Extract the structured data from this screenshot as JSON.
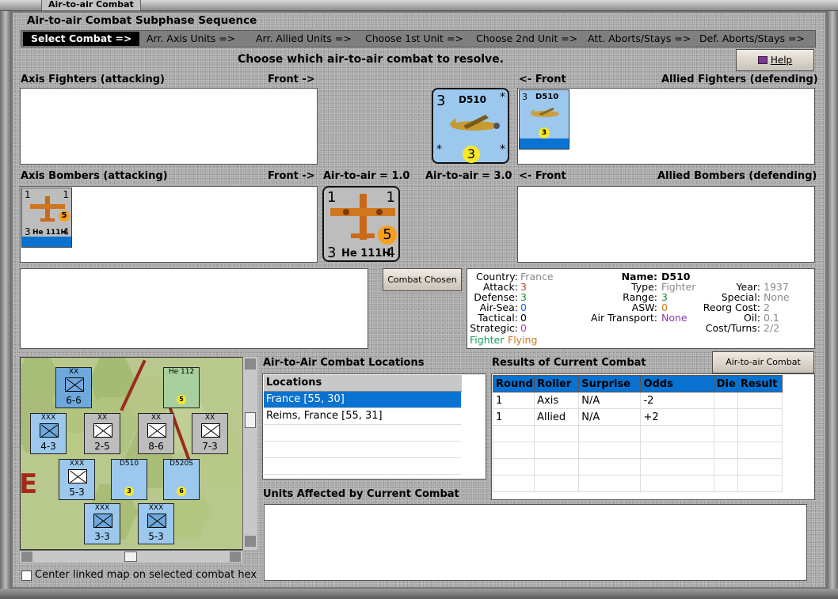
{
  "window": {
    "title": "Air-to-air Combat"
  },
  "sequence": {
    "group_title": "Air-to-air Combat Subphase Sequence",
    "steps": [
      "Select Combat =>",
      "Arr. Axis Units =>",
      "Arr. Allied Units =>",
      "Choose 1st Unit =>",
      "Choose 2nd Unit =>",
      "Att. Aborts/Stays =>",
      "Def. Aborts/Stays =>"
    ]
  },
  "instruction": "Choose which air-to-air combat to resolve.",
  "help_button": "Help",
  "axis_fighters": {
    "label": "Axis Fighters (attacking)",
    "front": "Front ->"
  },
  "allied_fighters": {
    "label": "Allied Fighters (defending)",
    "front": "<- Front"
  },
  "axis_bombers": {
    "label": "Axis Bombers (attacking)",
    "front": "Front ->",
    "air_to_air": "Air-to-air = 1.0"
  },
  "allied_bombers": {
    "label": "Allied Bombers (defending)",
    "front": "<- Front",
    "air_to_air": "Air-to-air = 3.0"
  },
  "allied_fighter_counter": {
    "name": "D510",
    "left_value": "3",
    "bottom_value": "3",
    "corner": "*"
  },
  "axis_bomber_counter": {
    "name": "He 111H",
    "top_left": "1",
    "top_right": "1",
    "bottom_left": "3",
    "bottom_right": "4",
    "badge": "5"
  },
  "combat_chosen_button": "Combat Chosen",
  "unit_info": {
    "country_label": "Country:",
    "country": "France",
    "attack_label": "Attack:",
    "attack": "3",
    "defense_label": "Defense:",
    "defense": "3",
    "air_sea_label": "Air-Sea:",
    "air_sea": "0",
    "tactical_label": "Tactical:",
    "tactical": "0",
    "strategic_label": "Strategic:",
    "strategic": "0",
    "tags": [
      "Fighter",
      "Flying"
    ],
    "name_label": "Name:",
    "name": "D510",
    "type_label": "Type:",
    "type": "Fighter",
    "range_label": "Range:",
    "range": "3",
    "asw_label": "ASW:",
    "asw": "0",
    "air_transport_label": "Air Transport:",
    "air_transport": "None",
    "year_label": "Year:",
    "year": "1937",
    "special_label": "Special:",
    "special": "None",
    "reorg_label": "Reorg Cost:",
    "reorg": "2",
    "oil_label": "Oil:",
    "oil": "0.1",
    "cost_label": "Cost/Turns:",
    "cost": "2/2",
    "colors": {
      "attack": "#c0392b",
      "defense": "#1a8a2e",
      "air_sea": "#1f5fd0",
      "strategic": "#b43ab4",
      "fighter": "#16a05a",
      "flying": "#c8781e",
      "muted": "#8a8a8a",
      "air_transport": "#8a3aa8",
      "asw": "#d07c1a"
    }
  },
  "locations": {
    "title": "Air-to-Air Combat Locations",
    "header": "Locations",
    "rows": [
      "France [55, 30]",
      "Reims, France [55, 31]",
      "",
      "",
      "",
      ""
    ]
  },
  "results": {
    "title": "Results of Current Combat",
    "chart_button": "Air-to-air Combat Chart",
    "columns": [
      "Round",
      "Roller",
      "Surprise",
      "Odds",
      "Die",
      "Result"
    ],
    "rows": [
      [
        "1",
        "Axis",
        "N/A",
        "-2",
        "",
        ""
      ],
      [
        "1",
        "Allied",
        "N/A",
        "+2",
        "",
        ""
      ],
      [
        "",
        "",
        "",
        "",
        "",
        ""
      ],
      [
        "",
        "",
        "",
        "",
        "",
        ""
      ],
      [
        "",
        "",
        "",
        "",
        "",
        ""
      ],
      [
        "",
        "",
        "",
        "",
        "",
        ""
      ]
    ]
  },
  "units_affected": {
    "title": "Units Affected by Current Combat"
  },
  "map": {
    "center_checkbox": "Center linked map on selected combat hex",
    "units": [
      {
        "type": "XXX",
        "str": "4-3",
        "color": "blue"
      },
      {
        "type": "XX",
        "str": "2-5",
        "color": "gray"
      },
      {
        "type": "XX",
        "str": "8-6",
        "color": "gray"
      },
      {
        "type": "XX",
        "str": "7-3",
        "color": "gray"
      },
      {
        "type": "XXX",
        "str": "5-3",
        "color": "blue"
      },
      {
        "type": "XXX",
        "str": "3-3",
        "color": "blue"
      },
      {
        "type": "XXX",
        "str": "5-3",
        "color": "blue"
      },
      {
        "type": "XX",
        "str": "6-6",
        "color": "blue"
      }
    ],
    "air_units": [
      "He 112",
      "D510",
      "D520S"
    ],
    "air_badges": [
      "5",
      "3",
      "6"
    ]
  }
}
